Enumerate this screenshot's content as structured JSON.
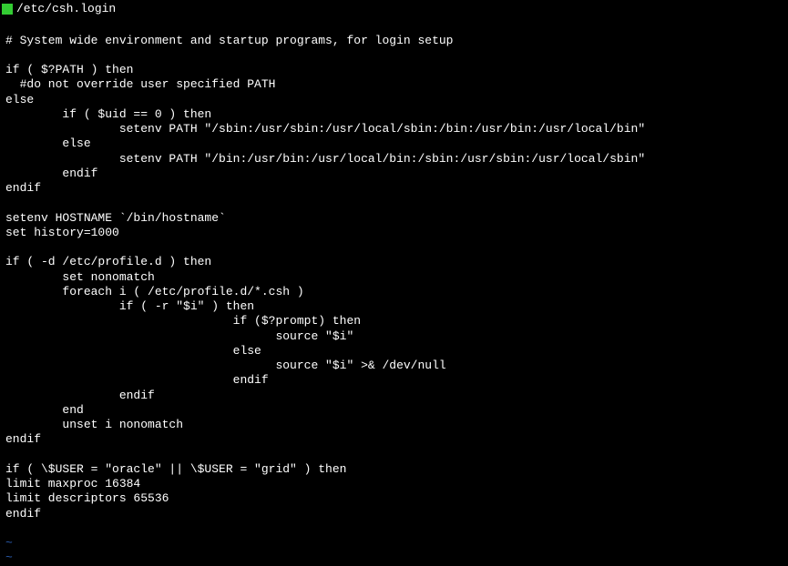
{
  "titlebar": {
    "path": "/etc/csh.login"
  },
  "lines": [
    "",
    "# System wide environment and startup programs, for login setup",
    "",
    "if ( $?PATH ) then",
    "  #do not override user specified PATH",
    "else",
    "        if ( $uid == 0 ) then",
    "                setenv PATH \"/sbin:/usr/sbin:/usr/local/sbin:/bin:/usr/bin:/usr/local/bin\"",
    "        else",
    "                setenv PATH \"/bin:/usr/bin:/usr/local/bin:/sbin:/usr/sbin:/usr/local/sbin\"",
    "        endif",
    "endif",
    "",
    "setenv HOSTNAME `/bin/hostname`",
    "set history=1000",
    "",
    "if ( -d /etc/profile.d ) then",
    "        set nonomatch",
    "        foreach i ( /etc/profile.d/*.csh )",
    "                if ( -r \"$i\" ) then",
    "                                if ($?prompt) then",
    "                                      source \"$i\"",
    "                                else",
    "                                      source \"$i\" >& /dev/null",
    "                                endif",
    "                endif",
    "        end",
    "        unset i nonomatch",
    "endif",
    "",
    "if ( \\$USER = \"oracle\" || \\$USER = \"grid\" ) then",
    "limit maxproc 16384",
    "limit descriptors 65536",
    "endif",
    ""
  ],
  "empty_marker": "~"
}
